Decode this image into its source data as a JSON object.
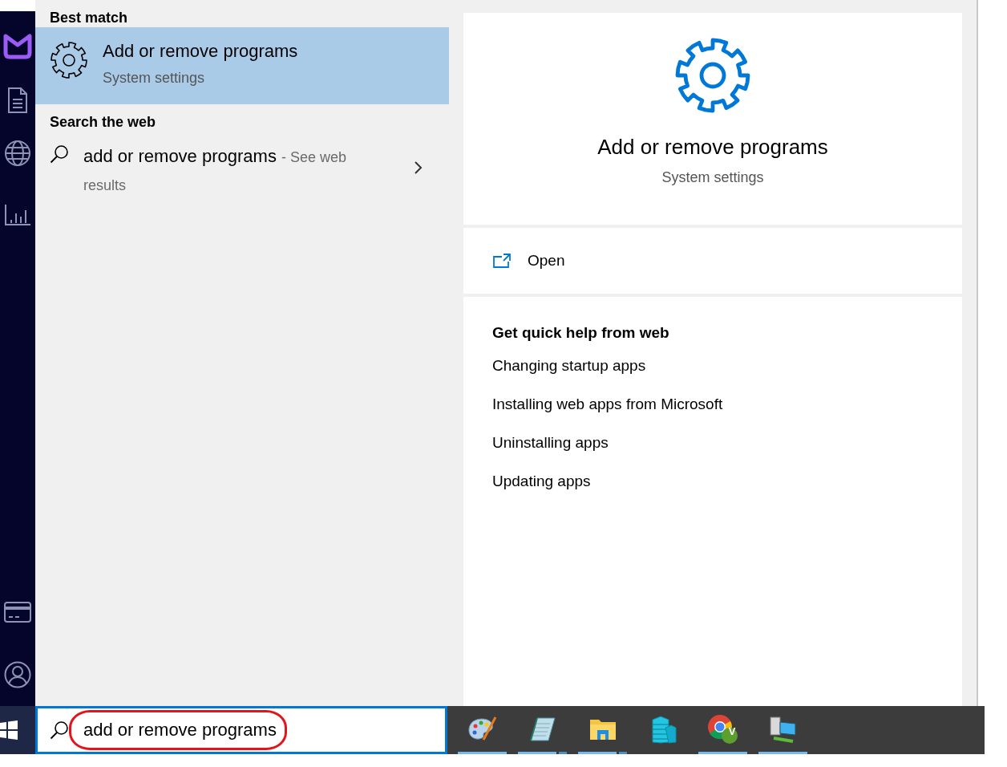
{
  "results": {
    "sections": [
      {
        "heading": "Best match",
        "items": [
          {
            "kind": "app",
            "title": "Add or remove programs",
            "subtitle": "System settings",
            "selected": true
          }
        ]
      },
      {
        "heading": "Search the web",
        "items": [
          {
            "kind": "web",
            "query": "add or remove programs",
            "suffix": "- See web results",
            "selected": false
          }
        ]
      }
    ]
  },
  "preview": {
    "title": "Add or remove programs",
    "subtitle": "System settings",
    "actions": [
      {
        "label": "Open"
      }
    ],
    "help": {
      "heading": "Get quick help from web",
      "links": [
        "Changing startup apps",
        "Installing web apps from Microsoft",
        "Uninstalling apps",
        "Updating apps"
      ]
    }
  },
  "search": {
    "value": "add or remove programs",
    "highlighted": true
  },
  "taskbar": {
    "apps": [
      {
        "kind": "paint",
        "running": true,
        "multiple": false
      },
      {
        "kind": "notepad",
        "running": true,
        "multiple": true
      },
      {
        "kind": "explorer",
        "running": true,
        "multiple": true
      },
      {
        "kind": "servers",
        "running": false,
        "multiple": false
      },
      {
        "kind": "chrome",
        "running": true,
        "multiple": false,
        "badge": "V"
      },
      {
        "kind": "network",
        "running": true,
        "multiple": false
      }
    ]
  }
}
